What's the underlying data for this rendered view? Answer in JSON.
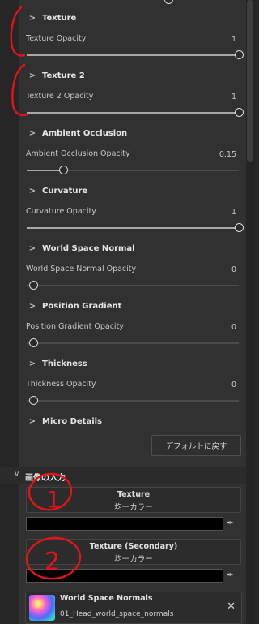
{
  "sections": [
    {
      "title": "Texture",
      "label": "Texture Opacity",
      "value": "1",
      "level": 1.0
    },
    {
      "title": "Texture 2",
      "label": "Texture 2 Opacity",
      "value": "1",
      "level": 1.0
    },
    {
      "title": "Ambient Occlusion",
      "label": "Ambient Occlusion Opacity",
      "value": "0.15",
      "level": 0.15
    },
    {
      "title": "Curvature",
      "label": "Curvature Opacity",
      "value": "1",
      "level": 1.0
    },
    {
      "title": "World Space Normal",
      "label": "World Space Normal Opacity",
      "value": "0",
      "level": 0.0
    },
    {
      "title": "Position Gradient",
      "label": "Position Gradient Opacity",
      "value": "0",
      "level": 0.0
    },
    {
      "title": "Thickness",
      "label": "Thickness Opacity",
      "value": "0",
      "level": 0.0
    }
  ],
  "micro_details": "Micro Details",
  "reset_button": "デフォルトに戻す",
  "image_inputs": {
    "title": "画像の入力",
    "inputs": [
      {
        "title": "Texture",
        "subtitle": "均一カラー"
      },
      {
        "title": "Texture (Secondary)",
        "subtitle": "均一カラー"
      }
    ],
    "texture": {
      "title": "World Space Normals",
      "subtitle": "01_Head_world_space_normals"
    }
  },
  "annotations": {
    "number_1": "1",
    "number_2": "2"
  },
  "colors": {
    "annotation_red": "#e3141a",
    "accent_swatch": "#000000"
  }
}
